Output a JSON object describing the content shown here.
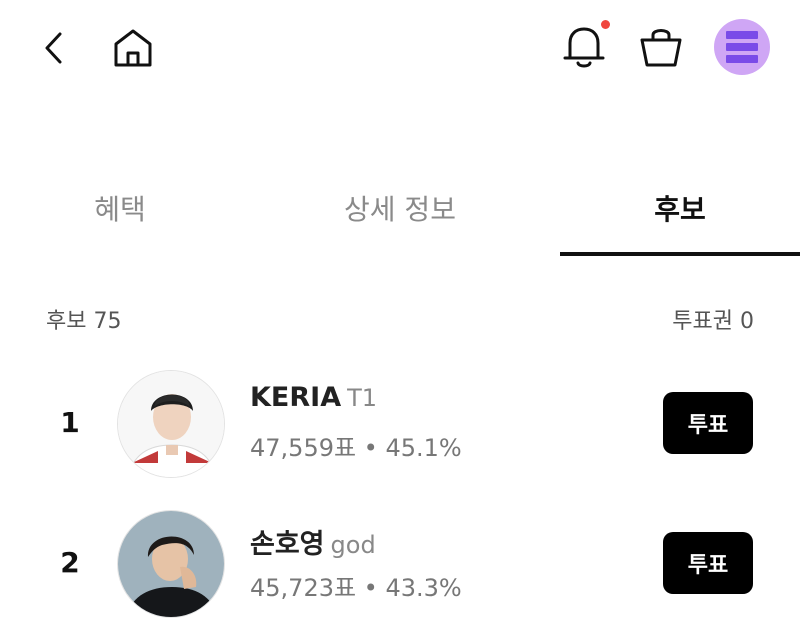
{
  "header": {
    "icons": [
      "back-arrow-icon",
      "home-icon",
      "bell-icon",
      "shopping-bag-icon",
      "menu-icon"
    ],
    "notification_dot_color": "#f0473e",
    "menu_avatar_color": "#cfa6f5"
  },
  "tabs": [
    {
      "label": "혜택",
      "active": false
    },
    {
      "label": "상세 정보",
      "active": false
    },
    {
      "label": "후보",
      "active": true
    }
  ],
  "summary": {
    "candidates_label": "후보 75",
    "tickets_label": "투표권 0"
  },
  "candidates": [
    {
      "rank": "1",
      "name": "KERIA",
      "team": "T1",
      "stats": "47,559표 • 45.1%",
      "vote_label": "투표"
    },
    {
      "rank": "2",
      "name": "손호영",
      "team": "god",
      "stats": "45,723표 • 43.3%",
      "vote_label": "투표"
    }
  ]
}
